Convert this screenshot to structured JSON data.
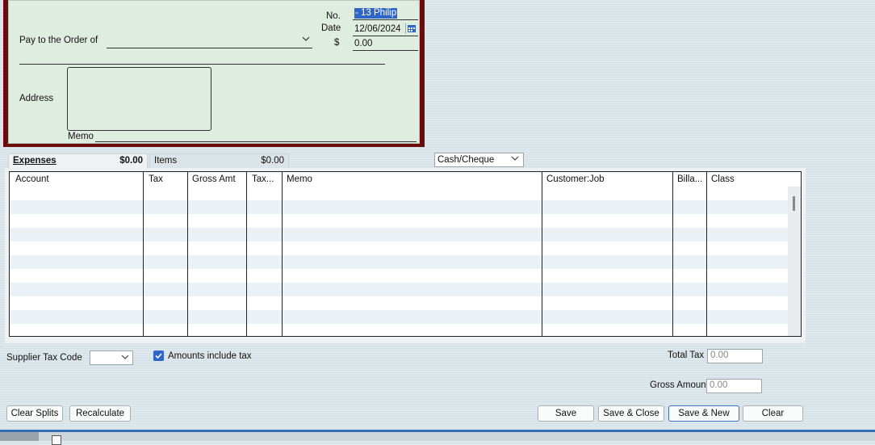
{
  "cheque": {
    "no_label": "No.",
    "no_value": "- 13 Philip",
    "date_label": "Date",
    "date_value": "12/06/2024",
    "amount_label": "$",
    "amount_value": "0.00",
    "pay_to_label": "Pay to the Order of",
    "address_label": "Address",
    "memo_label": "Memo",
    "border_color": "#6b0b0b",
    "background_color": "#dfece0"
  },
  "tabs": {
    "expenses_label": "Expenses",
    "expenses_amount": "$0.00",
    "items_label": "Items",
    "items_amount": "$0.00"
  },
  "payment_method": {
    "value": "Cash/Cheque"
  },
  "grid": {
    "columns": [
      "Account",
      "Tax",
      "Gross Amt",
      "Tax...",
      "Memo",
      "Customer:Job",
      "Billa...",
      "Class"
    ]
  },
  "bottom": {
    "supplier_tax_code_label": "Supplier Tax Code",
    "amounts_include_tax_label": "Amounts include tax",
    "amounts_include_tax_checked": true,
    "total_tax_label": "Total Tax",
    "total_tax_value": "0.00",
    "gross_amount_label": "Gross Amount",
    "gross_amount_value": "0.00"
  },
  "buttons": {
    "clear_splits": "Clear Splits",
    "recalculate": "Recalculate",
    "save": "Save",
    "save_close": "Save & Close",
    "save_new": "Save & New",
    "clear": "Clear"
  },
  "colors": {
    "accent": "#2e65c8",
    "row_alt": "#eaf1f7"
  },
  "icons": {
    "calendar": "calendar-icon",
    "dropdown": "chevron-down-icon",
    "checkbox": "checkmark-icon"
  }
}
